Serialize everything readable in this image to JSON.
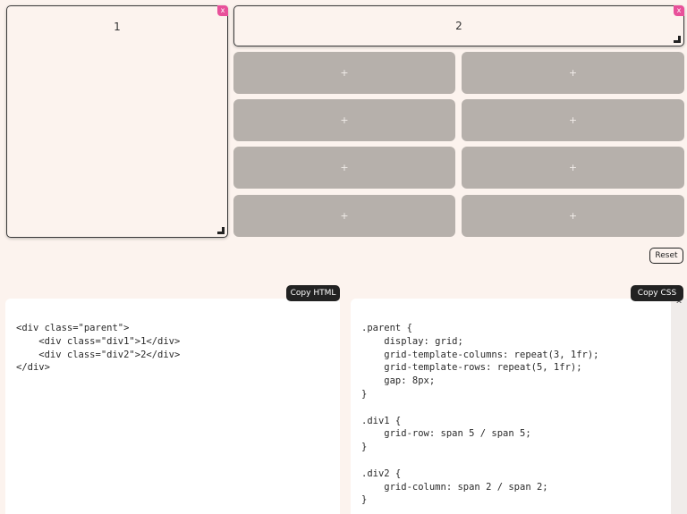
{
  "grid": {
    "items": [
      {
        "label": "1",
        "remove_label": "x"
      },
      {
        "label": "2",
        "remove_label": "x"
      }
    ],
    "add_cell_label": "+"
  },
  "controls": {
    "reset_label": "Reset",
    "copy_html_label": "Copy HTML",
    "copy_css_label": "Copy CSS"
  },
  "html_code": "<div class=\"parent\">\n    <div class=\"div1\">1</div>\n    <div class=\"div2\">2</div>\n</div>",
  "css_code": ".parent {\n    display: grid;\n    grid-template-columns: repeat(3, 1fr);\n    grid-template-rows: repeat(5, 1fr);\n    gap: 8px;\n}\n\n.div1 {\n    grid-row: span 5 / span 5;\n}\n\n.div2 {\n    grid-column: span 2 / span 2;\n}",
  "colors": {
    "background": "#fcf3ee",
    "cell_empty": "#b6b0ab",
    "close_accent": "#e8509a",
    "button_dark": "#222222"
  },
  "icons": {
    "close": "close-icon",
    "resize": "resize-handle-icon",
    "scroll_up": "chevron-up-icon"
  }
}
